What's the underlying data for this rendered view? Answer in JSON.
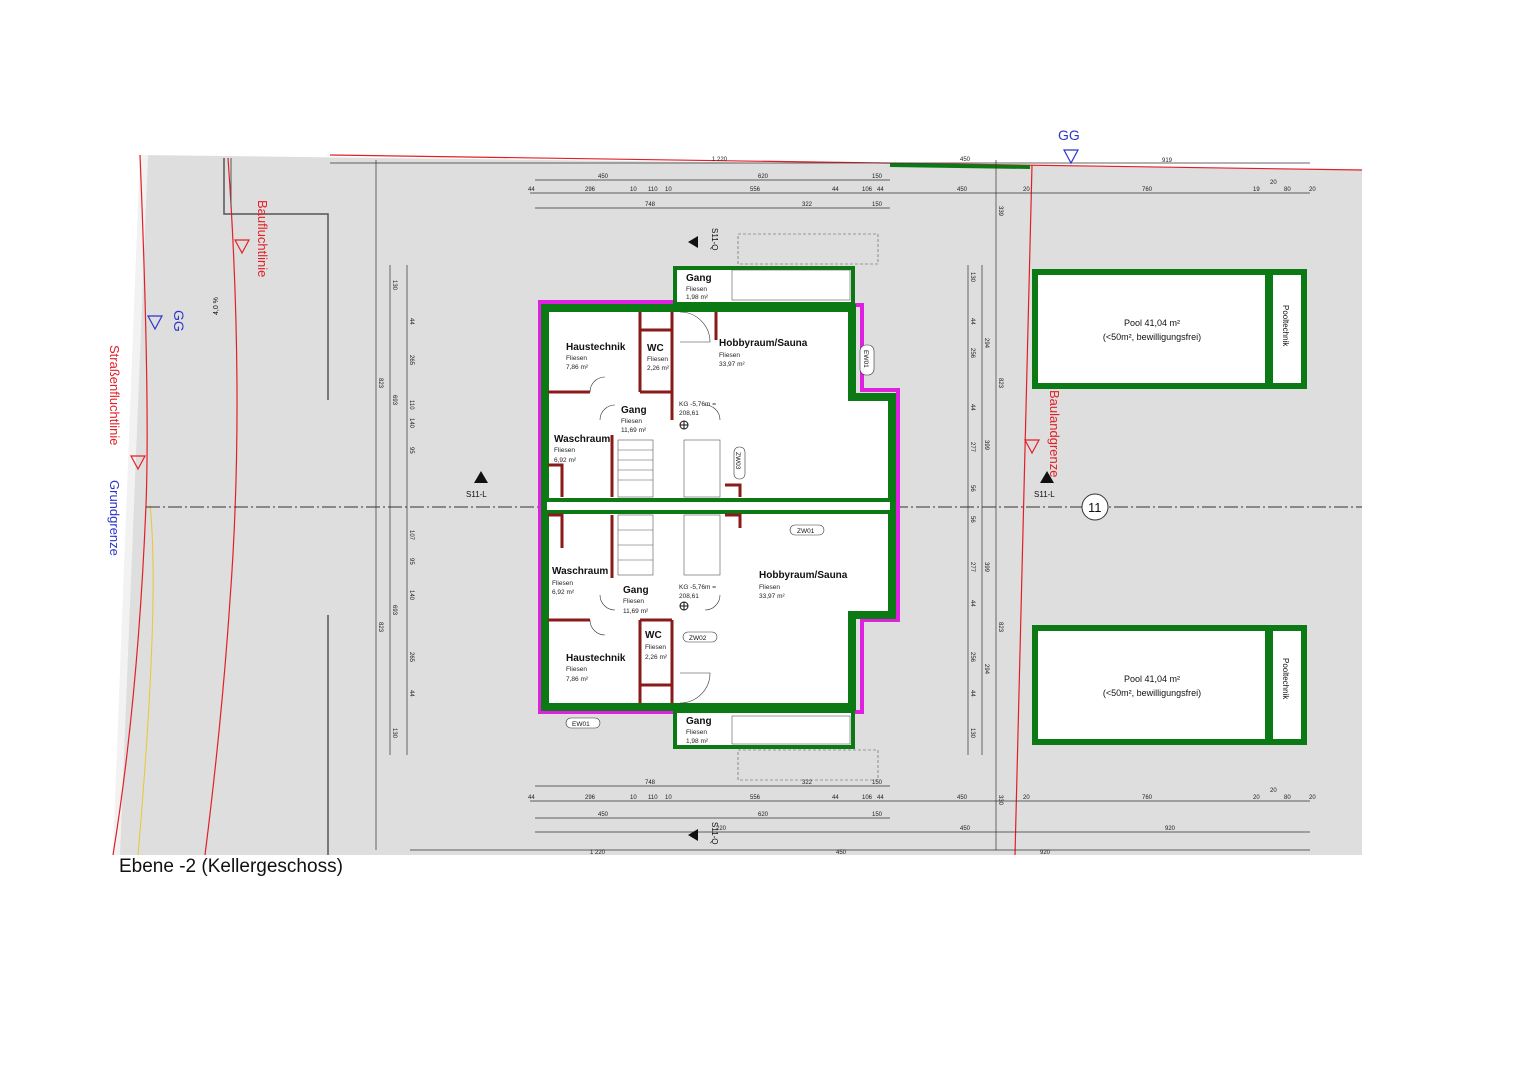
{
  "caption": "Ebene -2 (Kellergeschoss)",
  "lines": {
    "baufluchtlinie": "Baufluchtlinie",
    "strassenfluchtlinie": "Straßenfluchtlinie",
    "grundgrenze": "Grundgrenze",
    "baulandgrenze": "Baulandgrenze",
    "gg": "GG",
    "slope": "4,0 %"
  },
  "sections": {
    "s11q": "S11-Q",
    "s11l": "S11-L"
  },
  "axis_number": "11",
  "pools": {
    "upper": {
      "title": "Pool 41,04 m²",
      "note": "(<50m², bewilligungsfrei)",
      "tech": "Pooltechnik"
    },
    "lower": {
      "title": "Pool 41,04 m²",
      "note": "(<50m², bewilligungsfrei)",
      "tech": "Pooltechnik"
    }
  },
  "rooms": {
    "top_gang": {
      "name": "Gang",
      "floor": "Fliesen",
      "area": "1,98 m²"
    },
    "top_haustechnik": {
      "name": "Haustechnik",
      "floor": "Fliesen",
      "area": "7,86 m²"
    },
    "top_wc": {
      "name": "WC",
      "floor": "Fliesen",
      "area": "2,26 m²"
    },
    "top_hobby": {
      "name": "Hobbyraum/Sauna",
      "floor": "Fliesen",
      "area": "33,97 m²"
    },
    "top_gang2": {
      "name": "Gang",
      "floor": "Fliesen",
      "area": "11,69 m²"
    },
    "top_wasch": {
      "name": "Waschraum",
      "floor": "Fliesen",
      "area": "6,92 m²"
    },
    "bot_wasch": {
      "name": "Waschraum",
      "floor": "Fliesen",
      "area": "6,92 m²"
    },
    "bot_gang2": {
      "name": "Gang",
      "floor": "Fliesen",
      "area": "11,69 m²"
    },
    "bot_hobby": {
      "name": "Hobbyraum/Sauna",
      "floor": "Fliesen",
      "area": "33,97 m²"
    },
    "bot_wc": {
      "name": "WC",
      "floor": "Fliesen",
      "area": "2,26 m²"
    },
    "bot_haustechnik": {
      "name": "Haustechnik",
      "floor": "Fliesen",
      "area": "7,86 m²"
    },
    "bot_gang": {
      "name": "Gang",
      "floor": "Fliesen",
      "area": "1,98 m²"
    }
  },
  "levels": {
    "top": {
      "line1": "KG -5,76m =",
      "line2": "208,61"
    },
    "bot": {
      "line1": "KG -5,76m =",
      "line2": "208,61"
    }
  },
  "tags": {
    "ew01": "EW01",
    "zw01": "ZW01",
    "zw02": "ZW02",
    "zw03": "ZW03"
  },
  "dims": {
    "top_r1": [
      "1 220",
      "450",
      "919"
    ],
    "top_r2": [
      "450",
      "620",
      "150"
    ],
    "top_r3": [
      "44",
      "296",
      "10",
      "110",
      "10",
      "556",
      "44",
      "106",
      "44",
      "450",
      "20",
      "760",
      "19",
      "20",
      "80",
      "20"
    ],
    "top_r4": [
      "748",
      "322",
      "150"
    ],
    "bot_r1": [
      "748",
      "322",
      "150"
    ],
    "bot_r2": [
      "44",
      "296",
      "10",
      "110",
      "10",
      "556",
      "44",
      "106",
      "44",
      "450",
      "20",
      "760",
      "20",
      "20",
      "80",
      "20"
    ],
    "bot_r3": [
      "450",
      "620",
      "150",
      "220",
      "450",
      "920"
    ],
    "bot_r4": [
      "1 220",
      "450",
      "920"
    ],
    "left_v": [
      "130",
      "44",
      "265",
      "110",
      "140",
      "95",
      "107",
      "95",
      "140",
      "265",
      "44",
      "130"
    ],
    "left_v2": [
      "823",
      "693",
      "823",
      "693"
    ],
    "right_v": [
      "130",
      "44",
      "256",
      "44",
      "277",
      "56",
      "56",
      "277",
      "44",
      "256",
      "44",
      "130"
    ],
    "right_v2": [
      "294",
      "399",
      "399",
      "294"
    ],
    "right_v3": [
      "339",
      "823",
      "823",
      "330"
    ]
  },
  "colors": {
    "wall": "#0c7a14",
    "partition": "#8b1a1a",
    "insulation": "#e020e0",
    "site": "#dedede",
    "lines_red": "#e41e26",
    "lines_blue": "#2b36c8"
  }
}
